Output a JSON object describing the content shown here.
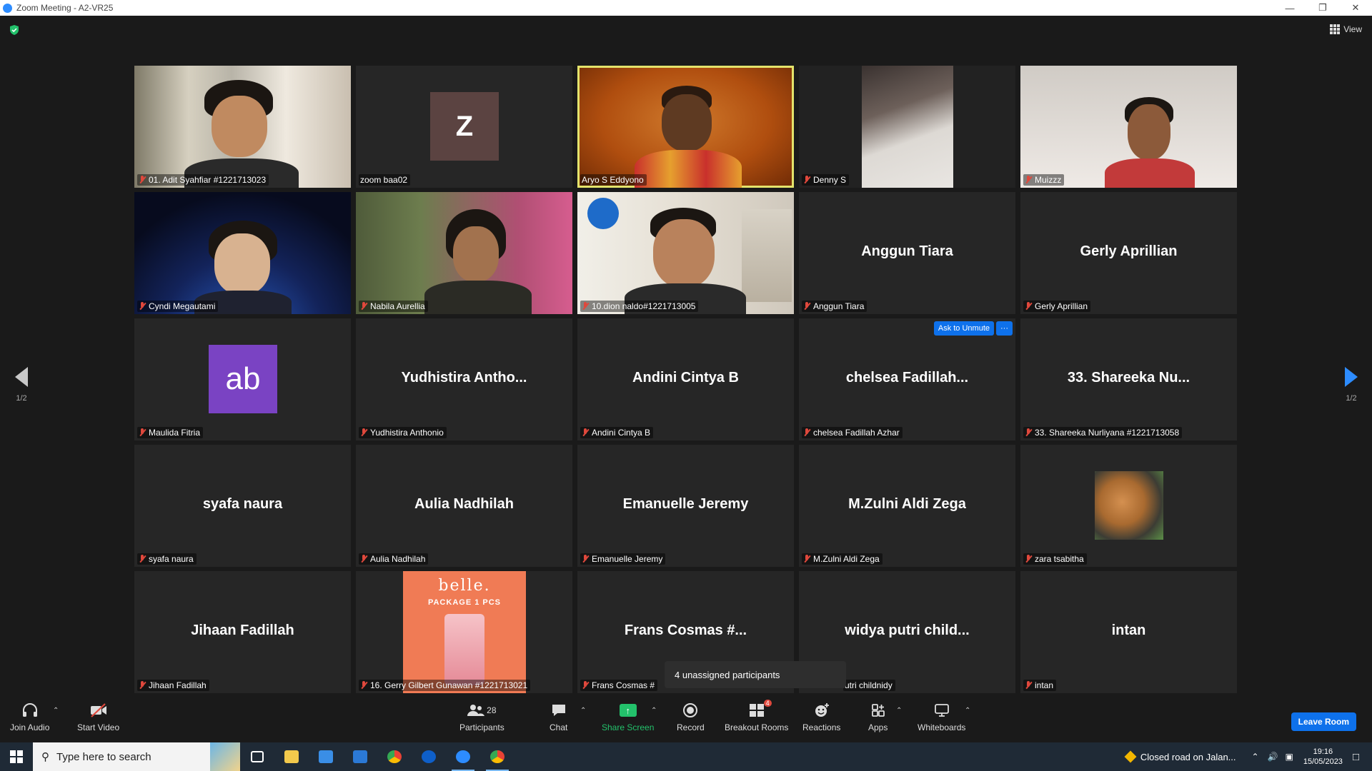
{
  "window": {
    "title": "Zoom Meeting - A2-VR25"
  },
  "view_label": "View",
  "page_indicator": {
    "left": "1/2",
    "right": "1/2"
  },
  "tiles": [
    {
      "name": "01. Adit Syahfiar #1221713023"
    },
    {
      "name": "zoom baa02",
      "avatar": "Z"
    },
    {
      "name": "Aryo S Eddyono"
    },
    {
      "name": "Denny S"
    },
    {
      "name": "Muizzz"
    },
    {
      "name": "Cyndi Megautami"
    },
    {
      "name": "Nabila Aurellia"
    },
    {
      "name": "10.dion naldo#1221713005"
    },
    {
      "name": "Anggun Tiara",
      "display": "Anggun Tiara"
    },
    {
      "name": "Gerly Aprillian",
      "display": "Gerly Aprillian"
    },
    {
      "name": "Maulida Fitria",
      "avatar": "ab"
    },
    {
      "name": "Yudhistira Anthonio",
      "display": "Yudhistira  Antho..."
    },
    {
      "name": "Andini Cintya B",
      "display": "Andini Cintya B"
    },
    {
      "name": "chelsea Fadillah Azhar",
      "display": "chelsea  Fadillah..."
    },
    {
      "name": "33. Shareeka Nurliyana #1221713058",
      "display": "33. Shareeka Nu..."
    },
    {
      "name": "syafa naura",
      "display": "syafa naura"
    },
    {
      "name": "Aulia Nadhilah",
      "display": "Aulia Nadhilah"
    },
    {
      "name": "Emanuelle Jeremy",
      "display": "Emanuelle Jeremy"
    },
    {
      "name": "M.Zulni Aldi Zega",
      "display": "M.Zulni Aldi Zega"
    },
    {
      "name": "zara tsabitha"
    },
    {
      "name": "Jihaan Fadillah",
      "display": "Jihaan Fadillah"
    },
    {
      "name": "16. Gerry Gilbert Gunawan #1221713021"
    },
    {
      "name": "Frans Cosmas #",
      "display": "Frans Cosmas #..."
    },
    {
      "name": "utri childnidy",
      "display": "widya putri child..."
    },
    {
      "name": "intan",
      "display": "intan"
    }
  ],
  "belle": {
    "brand": "belle.",
    "package": "PACKAGE 1 PCS"
  },
  "ask_unmute": {
    "label": "Ask to Unmute",
    "more": "···"
  },
  "tooltip": "4 unassigned participants",
  "toolbar": {
    "join_audio": "Join Audio",
    "start_video": "Start Video",
    "participants": "Participants",
    "participant_count": "28",
    "chat": "Chat",
    "share_screen": "Share Screen",
    "record": "Record",
    "breakout_rooms": "Breakout Rooms",
    "breakout_badge": "4",
    "reactions": "Reactions",
    "apps": "Apps",
    "whiteboards": "Whiteboards",
    "leave": "Leave Room"
  },
  "taskbar": {
    "search_placeholder": "Type here to search",
    "notification": "Closed road on Jalan...",
    "time": "19:16",
    "date": "15/05/2023"
  },
  "colors": {
    "active_speaker": "#e4e36b",
    "zoom_blue": "#0e71eb",
    "share_green": "#23c16b",
    "muted_red": "#e0483c"
  }
}
